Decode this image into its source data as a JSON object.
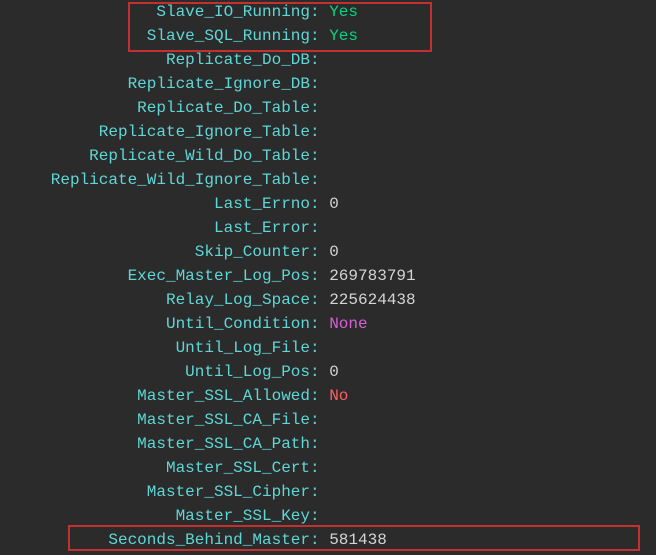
{
  "terminal": {
    "rows": [
      {
        "label": "Slave_IO_Running",
        "value": "Yes",
        "valueClass": "value-yes"
      },
      {
        "label": "Slave_SQL_Running",
        "value": "Yes",
        "valueClass": "value-yes"
      },
      {
        "label": "Replicate_Do_DB",
        "value": "",
        "valueClass": ""
      },
      {
        "label": "Replicate_Ignore_DB",
        "value": "",
        "valueClass": ""
      },
      {
        "label": "Replicate_Do_Table",
        "value": "",
        "valueClass": ""
      },
      {
        "label": "Replicate_Ignore_Table",
        "value": "",
        "valueClass": ""
      },
      {
        "label": "Replicate_Wild_Do_Table",
        "value": "",
        "valueClass": ""
      },
      {
        "label": "Replicate_Wild_Ignore_Table",
        "value": "",
        "valueClass": ""
      },
      {
        "label": "Last_Errno",
        "value": "0",
        "valueClass": ""
      },
      {
        "label": "Last_Error",
        "value": "",
        "valueClass": ""
      },
      {
        "label": "Skip_Counter",
        "value": "0",
        "valueClass": ""
      },
      {
        "label": "Exec_Master_Log_Pos",
        "value": "269783791",
        "valueClass": ""
      },
      {
        "label": "Relay_Log_Space",
        "value": "225624438",
        "valueClass": ""
      },
      {
        "label": "Until_Condition",
        "value": "None",
        "valueClass": "value-none"
      },
      {
        "label": "Until_Log_File",
        "value": "",
        "valueClass": ""
      },
      {
        "label": "Until_Log_Pos",
        "value": "0",
        "valueClass": ""
      },
      {
        "label": "Master_SSL_Allowed",
        "value": "No",
        "valueClass": "value-no"
      },
      {
        "label": "Master_SSL_CA_File",
        "value": "",
        "valueClass": ""
      },
      {
        "label": "Master_SSL_CA_Path",
        "value": "",
        "valueClass": ""
      },
      {
        "label": "Master_SSL_Cert",
        "value": "",
        "valueClass": ""
      },
      {
        "label": "Master_SSL_Cipher",
        "value": "",
        "valueClass": ""
      },
      {
        "label": "Master_SSL_Key",
        "value": "",
        "valueClass": ""
      },
      {
        "label": "Seconds_Behind_Master",
        "value": "581438",
        "valueClass": ""
      }
    ]
  }
}
